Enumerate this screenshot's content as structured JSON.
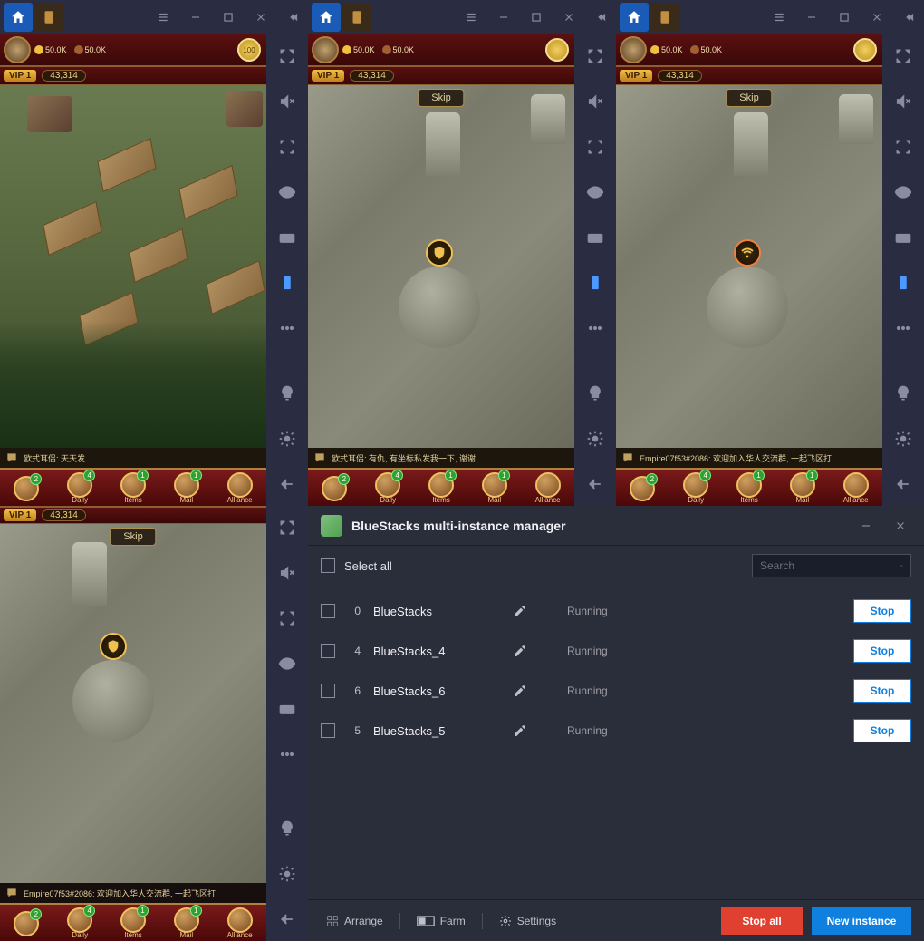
{
  "titlebar": {
    "menu": "≡"
  },
  "hud": {
    "gold": "50.0K",
    "wood": "50.0K",
    "vip": "VIP 1",
    "power": "43,314",
    "coin": "100",
    "skip": "Skip"
  },
  "chat": {
    "msg1": "欧式耳侣: 天天发",
    "msg2": "欧式耳侣: 有仇, 有坐标私发我一下, 谢谢...",
    "msg3": "Empire07f53#2086: 欢迎加入华人交流群, 一起飞区打"
  },
  "nav": {
    "items": [
      {
        "label": "",
        "badge": "2"
      },
      {
        "label": "Daily",
        "badge": "4"
      },
      {
        "label": "Items",
        "badge": "1"
      },
      {
        "label": "Mail",
        "badge": "1"
      },
      {
        "label": "Alliance",
        "badge": ""
      }
    ]
  },
  "manager": {
    "title": "BlueStacks multi-instance manager",
    "select_all": "Select all",
    "search_placeholder": "Search",
    "rows": [
      {
        "idx": "0",
        "name": "BlueStacks",
        "status": "Running",
        "action": "Stop"
      },
      {
        "idx": "4",
        "name": "BlueStacks_4",
        "status": "Running",
        "action": "Stop"
      },
      {
        "idx": "6",
        "name": "BlueStacks_6",
        "status": "Running",
        "action": "Stop"
      },
      {
        "idx": "5",
        "name": "BlueStacks_5",
        "status": "Running",
        "action": "Stop"
      }
    ],
    "footer": {
      "arrange": "Arrange",
      "farm": "Farm",
      "settings": "Settings",
      "stop_all": "Stop all",
      "new_instance": "New instance"
    }
  }
}
